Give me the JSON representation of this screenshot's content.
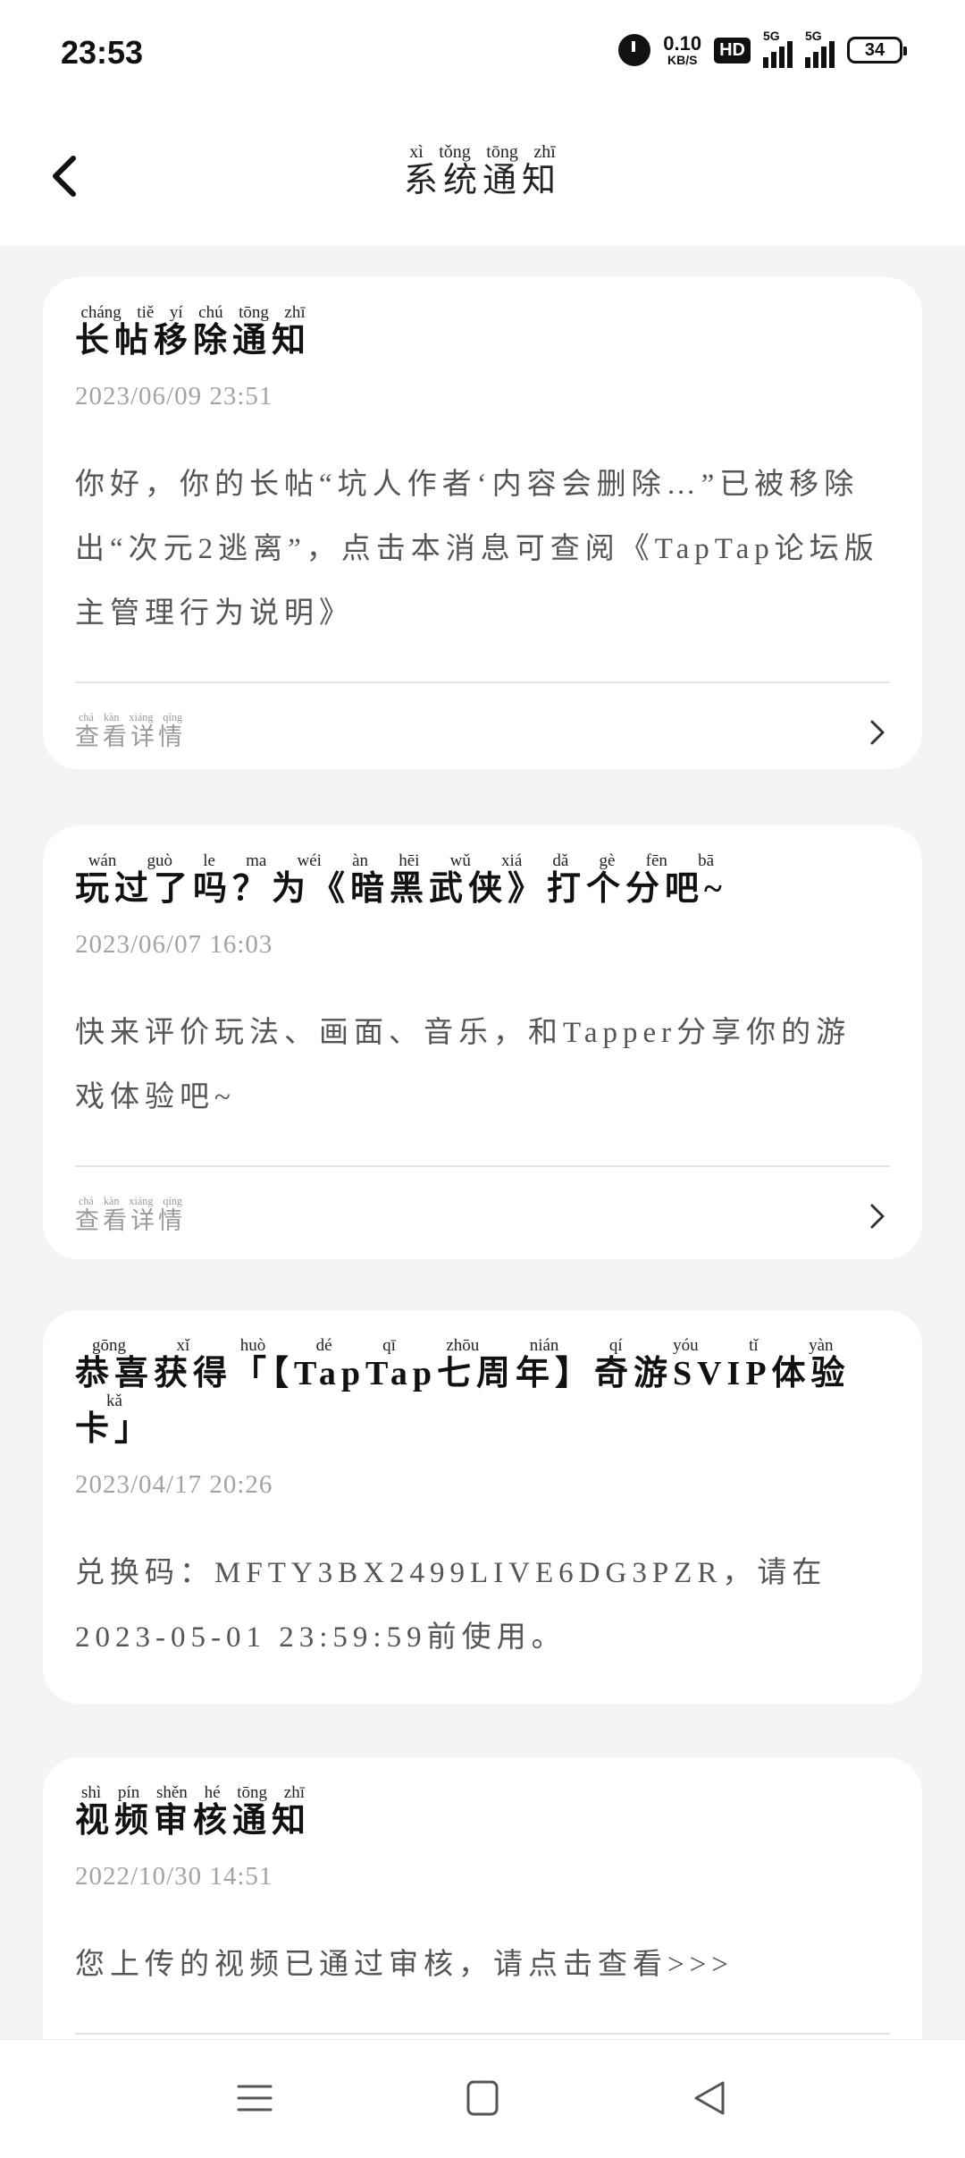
{
  "status_bar": {
    "time": "23:53",
    "net_speed_value": "0.10",
    "net_speed_unit": "KB/S",
    "hd_badge": "HD",
    "signal_1": "5G",
    "signal_2": "5G",
    "battery": "34"
  },
  "header": {
    "title": "系统通知",
    "title_pinyin": "xì tǒng tōng zhī",
    "back_icon": "chevron-left-icon"
  },
  "notifications": [
    {
      "title": "长帖移除通知",
      "title_pinyin": "cháng tiě yí chú tōng zhī",
      "date": "2023/06/09 23:51",
      "body": "你好，你的长帖“坑人作者‘内容会删除…”已被移除出“次元2逃离”，点击本消息可查阅《TapTap论坛版主管理行为说明》",
      "link": "查看详情",
      "link_pinyin": "chá kàn xiáng qíng"
    },
    {
      "title": "玩过了吗？为《暗黑武侠》打个分吧~",
      "title_pinyin": "wán guò le ma   wéi   àn hēi wǔ xiá   dǎ gè fēn bā",
      "date": "2023/06/07 16:03",
      "body": "快来评价玩法、画面、音乐，和Tapper分享你的游戏体验吧~",
      "link": "查看详情",
      "link_pinyin": "chá kàn xiáng qíng"
    },
    {
      "title": "恭喜获得「【TapTap七周年】奇游SVIP体验卡」",
      "title_pinyin": "gōng xǐ huò dé   qī zhōu nián   qí yóu   tǐ yàn kǎ",
      "date": "2023/04/17 20:26",
      "body": "兑换码：MFTY3BX2499LIVE6DG3PZR，请在2023-05-01 23:59:59前使用。"
    },
    {
      "title": "视频审核通知",
      "title_pinyin": "shì pín shěn hé tōng zhī",
      "date": "2022/10/30 14:51",
      "body": "您上传的视频已通过审核，请点击查看>>>"
    }
  ],
  "nav_bar": {
    "menu_icon": "menu-icon",
    "home_icon": "home-square-icon",
    "back_icon": "back-triangle-icon"
  }
}
